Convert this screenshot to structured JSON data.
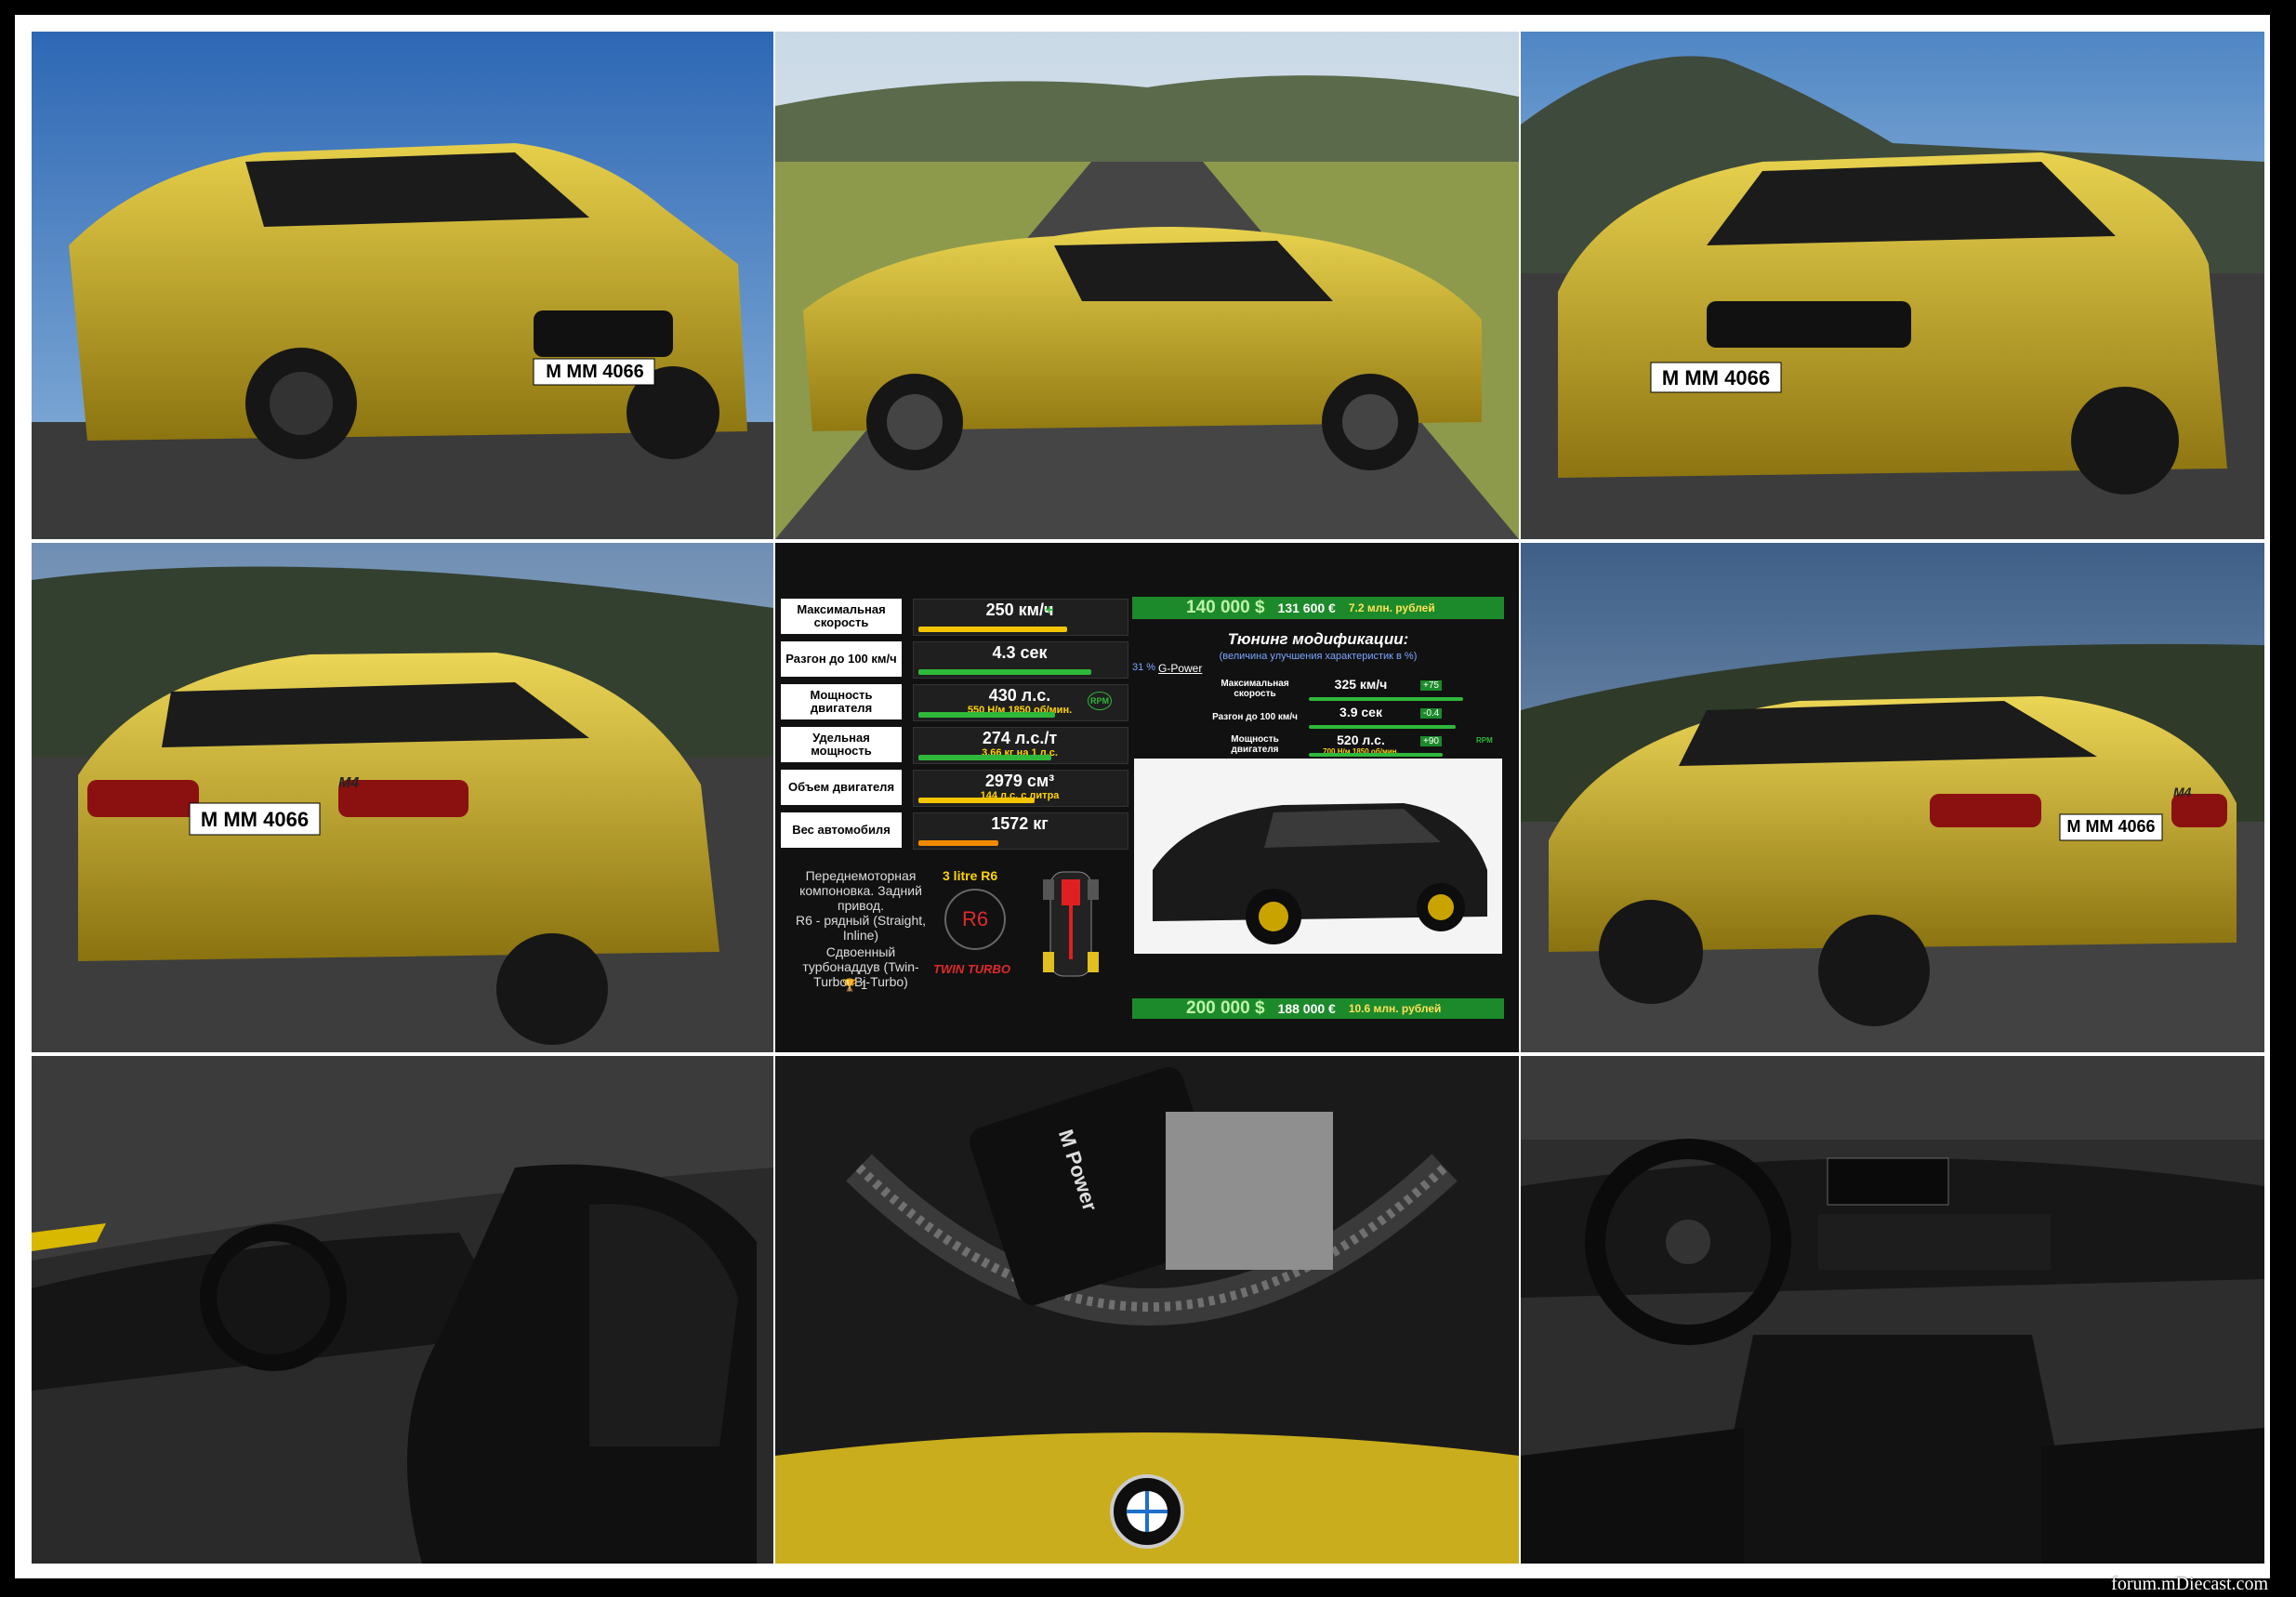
{
  "photos": [
    {
      "name": "photo-front-left",
      "plate": "M MM 4066"
    },
    {
      "name": "photo-side-track"
    },
    {
      "name": "photo-front-right",
      "plate": "M MM 4066"
    },
    {
      "name": "photo-rear-left",
      "plate": "M MM 4066",
      "badge": "M4"
    },
    {
      "name": "photo-rear-right",
      "plate": "M MM 4066",
      "badge": "M4"
    },
    {
      "name": "photo-interior-side"
    },
    {
      "name": "photo-engine-bay",
      "engine_text": "M Power"
    },
    {
      "name": "photo-interior-dash"
    }
  ],
  "specs": {
    "rows": [
      {
        "label": "Максимальная скорость",
        "value": "250 км/ч",
        "extra": "+",
        "fill": 0.74,
        "color": "#f2c500"
      },
      {
        "label": "Разгон до 100 км/ч",
        "value": "4.3 сек",
        "fill": 0.86,
        "color": "#2fb83a"
      },
      {
        "label": "Мощность двигателя",
        "value": "430 л.с.",
        "sub": "550 Н/м 1850 об/мин.",
        "icon": "RPM",
        "fill": 0.68,
        "color": "#2fb83a"
      },
      {
        "label": "Удельная мощность",
        "value": "274 л.с./т",
        "sub": "3.66 кг на 1 л.с.",
        "fill": 0.66,
        "color": "#2fb83a"
      },
      {
        "label": "Объем двигателя",
        "value": "2979 см³",
        "sub": "144 л.с. с литра",
        "fill": 0.58,
        "color": "#f2c500"
      },
      {
        "label": "Вес автомобиля",
        "value": "1572 кг",
        "fill": 0.4,
        "color": "#f28a00"
      }
    ],
    "layout_text": "Переднемоторная компоновка. Задний привод.",
    "engine_text": "R6 - рядный (Straight, Inline)",
    "turbo_text": "Сдвоенный турбонаддув (Twin-Turbo, Bi-Turbo)",
    "trophy_count": "1",
    "engine_summary": "3 litre R6",
    "engine_badge": "R6",
    "twin_turbo": "TWIN TURBO",
    "price_top": {
      "usd": "140 000 $",
      "eur": "131 600 €",
      "rub": "7.2 млн. рублей"
    },
    "price_bottom": {
      "usd": "200 000 $",
      "eur": "188 000 €",
      "rub": "10.6 млн. рублей"
    },
    "tuning": {
      "title": "Тюнинг модификации:",
      "subtitle": "(величина улучшения характеристик в %)",
      "percent": "31 %",
      "tuner": "G-Power",
      "rows": [
        {
          "label": "Максимальная скорость",
          "value": "325 км/ч",
          "delta": "+75",
          "fill": 0.92
        },
        {
          "label": "Разгон до 100 км/ч",
          "value": "3.9 сек",
          "delta": "-0.4",
          "fill": 0.88
        },
        {
          "label": "Мощность двигателя",
          "value": "520 л.с.",
          "sub": "700 Н/м 1850 об/мин.",
          "delta": "+90",
          "icon": "RPM",
          "fill": 0.8
        }
      ]
    }
  },
  "watermark": "forum.mDiecast.com",
  "colors": {
    "car": "#c9ad1c",
    "bg": "#000000",
    "price": "#1c8a2a"
  }
}
